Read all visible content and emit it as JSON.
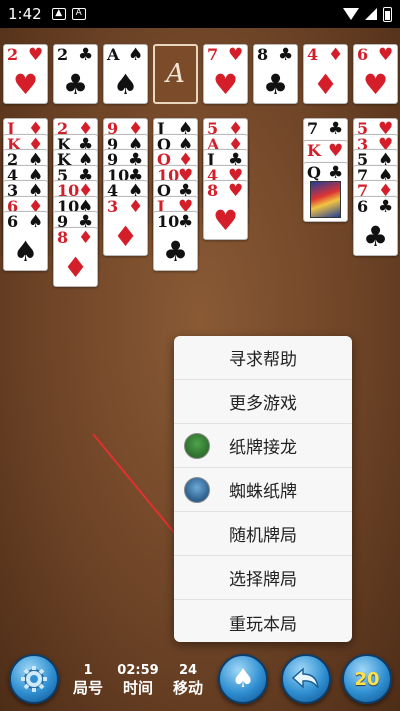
{
  "status_bar": {
    "time": "1:42"
  },
  "foundations": [
    {
      "rank": "2",
      "suit": "♥",
      "color": "red"
    },
    {
      "rank": "2",
      "suit": "♣",
      "color": "black"
    },
    {
      "rank": "A",
      "suit": "♠",
      "color": "black"
    },
    {
      "empty_label": "A"
    }
  ],
  "free_cells": [
    {
      "rank": "7",
      "suit": "♥",
      "color": "red"
    },
    {
      "rank": "8",
      "suit": "♣",
      "color": "black"
    },
    {
      "rank": "4",
      "suit": "♦",
      "color": "red"
    },
    {
      "rank": "6",
      "suit": "♥",
      "color": "red"
    }
  ],
  "columns": [
    [
      {
        "rank": "J",
        "suit": "♦",
        "color": "red"
      },
      {
        "rank": "K",
        "suit": "♦",
        "color": "red"
      },
      {
        "rank": "2",
        "suit": "♠",
        "color": "black"
      },
      {
        "rank": "4",
        "suit": "♠",
        "color": "black"
      },
      {
        "rank": "3",
        "suit": "♠",
        "color": "black"
      },
      {
        "rank": "6",
        "suit": "♦",
        "color": "red"
      },
      {
        "rank": "6",
        "suit": "♠",
        "color": "black"
      }
    ],
    [
      {
        "rank": "2",
        "suit": "♦",
        "color": "red"
      },
      {
        "rank": "K",
        "suit": "♣",
        "color": "black"
      },
      {
        "rank": "K",
        "suit": "♠",
        "color": "black"
      },
      {
        "rank": "5",
        "suit": "♣",
        "color": "black"
      },
      {
        "rank": "10",
        "suit": "♦",
        "color": "red"
      },
      {
        "rank": "10",
        "suit": "♠",
        "color": "black"
      },
      {
        "rank": "9",
        "suit": "♣",
        "color": "black"
      },
      {
        "rank": "8",
        "suit": "♦",
        "color": "red"
      }
    ],
    [
      {
        "rank": "9",
        "suit": "♦",
        "color": "red"
      },
      {
        "rank": "9",
        "suit": "♠",
        "color": "black"
      },
      {
        "rank": "9",
        "suit": "♣",
        "color": "black"
      },
      {
        "rank": "10",
        "suit": "♣",
        "color": "black"
      },
      {
        "rank": "4",
        "suit": "♠",
        "color": "black"
      },
      {
        "rank": "3",
        "suit": "♦",
        "color": "red"
      }
    ],
    [
      {
        "rank": "J",
        "suit": "♠",
        "color": "black"
      },
      {
        "rank": "Q",
        "suit": "♠",
        "color": "black"
      },
      {
        "rank": "Q",
        "suit": "♦",
        "color": "red"
      },
      {
        "rank": "10",
        "suit": "♥",
        "color": "red"
      },
      {
        "rank": "Q",
        "suit": "♣",
        "color": "black"
      },
      {
        "rank": "J",
        "suit": "♥",
        "color": "red"
      },
      {
        "rank": "10",
        "suit": "♣",
        "color": "black"
      }
    ],
    [
      {
        "rank": "5",
        "suit": "♦",
        "color": "red"
      },
      {
        "rank": "A",
        "suit": "♦",
        "color": "red"
      },
      {
        "rank": "J",
        "suit": "♣",
        "color": "black"
      },
      {
        "rank": "4",
        "suit": "♥",
        "color": "red"
      },
      {
        "rank": "8",
        "suit": "♥",
        "color": "red"
      }
    ],
    [],
    [
      {
        "rank": "7",
        "suit": "♣",
        "color": "black"
      },
      {
        "rank": "K",
        "suit": "♥",
        "color": "red"
      },
      {
        "rank": "Q",
        "suit": "♣",
        "color": "black",
        "face": true
      }
    ],
    [
      {
        "rank": "5",
        "suit": "♥",
        "color": "red"
      },
      {
        "rank": "3",
        "suit": "♥",
        "color": "red"
      },
      {
        "rank": "5",
        "suit": "♠",
        "color": "black"
      },
      {
        "rank": "7",
        "suit": "♠",
        "color": "black"
      },
      {
        "rank": "7",
        "suit": "♦",
        "color": "red"
      },
      {
        "rank": "6",
        "suit": "♣",
        "color": "black"
      }
    ]
  ],
  "menu": {
    "items": [
      {
        "label": "寻求帮助",
        "icon": null
      },
      {
        "label": "更多游戏",
        "icon": null
      },
      {
        "label": "纸牌接龙",
        "icon": "solitaire-app-icon"
      },
      {
        "label": "蜘蛛纸牌",
        "icon": "spider-app-icon"
      },
      {
        "label": "随机牌局",
        "icon": null
      },
      {
        "label": "选择牌局",
        "icon": null
      },
      {
        "label": "重玩本局",
        "icon": null
      }
    ]
  },
  "bottom_bar": {
    "game_number": {
      "value": "1",
      "label": "局号"
    },
    "time": {
      "value": "02:59",
      "label": "时间"
    },
    "moves": {
      "value": "24",
      "label": "移动"
    },
    "hint_count": "20"
  },
  "colors": {
    "felt": "#6e4427",
    "red_suit": "#d41f2a",
    "black_suit": "#111111",
    "button_blue": "#2f8fd1",
    "arrow_red": "#e0312f"
  }
}
